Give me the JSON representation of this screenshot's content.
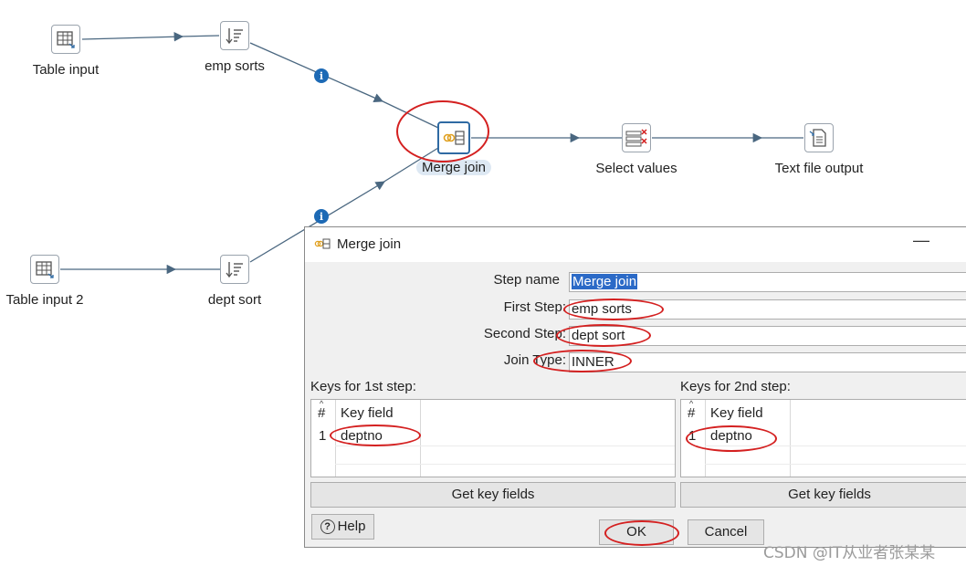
{
  "canvas": {
    "steps": {
      "table_input": "Table input",
      "emp_sorts": "emp sorts",
      "merge_join": "Merge join",
      "select_values": "Select values",
      "text_file_output": "Text file output",
      "table_input_2": "Table input 2",
      "dept_sort": "dept sort"
    },
    "info_glyph": "i"
  },
  "dialog": {
    "title": "Merge join",
    "minimize_glyph": "—",
    "fields": {
      "step_name_label": "Step name",
      "step_name_value": "Merge join",
      "first_step_label": "First Step:",
      "first_step_value": "emp sorts",
      "second_step_label": "Second Step:",
      "second_step_value": "dept sort",
      "join_type_label": "Join Type:",
      "join_type_value": "INNER"
    },
    "keys1": {
      "label": "Keys for 1st step:",
      "col_hash": "#",
      "col_key": "Key field",
      "rows": [
        {
          "num": "1",
          "value": "deptno"
        }
      ],
      "button": "Get key fields"
    },
    "keys2": {
      "label": "Keys for 2nd step:",
      "col_hash": "#",
      "col_key": "Key field",
      "rows": [
        {
          "num": "1",
          "value": "deptno"
        }
      ],
      "button": "Get key fields"
    },
    "buttons": {
      "help": "Help",
      "help_glyph": "?",
      "ok": "OK",
      "cancel": "Cancel"
    }
  },
  "watermark": "CSDN @IT从业者张某某",
  "colors": {
    "hop": "#4a6780",
    "annotation": "#d42020",
    "accent": "#2f6aa3",
    "info": "#1d6ab5"
  }
}
